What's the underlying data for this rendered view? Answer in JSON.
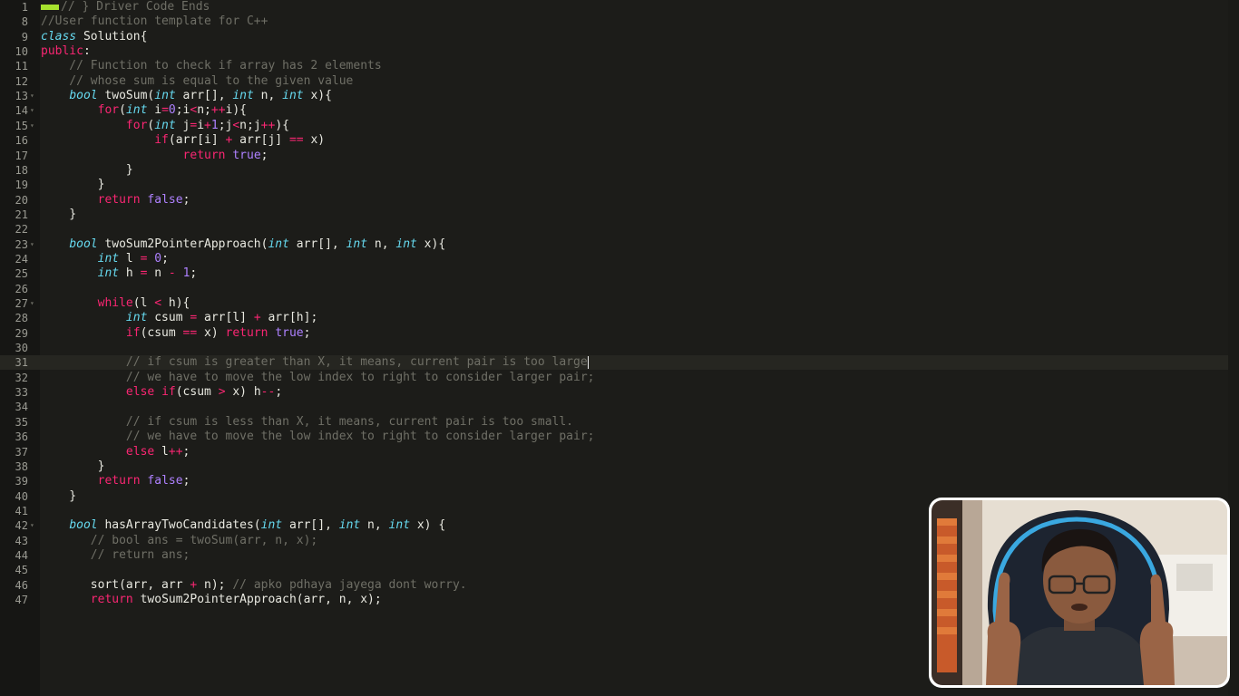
{
  "editor": {
    "lines": [
      {
        "n": "1",
        "fold": "",
        "tokens": [
          {
            "c": "bar",
            "t": ""
          },
          {
            "c": "cm",
            "t": "// } Driver Code Ends"
          }
        ]
      },
      {
        "n": "8",
        "fold": "",
        "tokens": [
          {
            "c": "cm",
            "t": "//User function template for C++"
          }
        ]
      },
      {
        "n": "9",
        "fold": "",
        "tokens": [
          {
            "c": "ty",
            "t": "class"
          },
          {
            "c": "plain",
            "t": " Solution{"
          }
        ]
      },
      {
        "n": "10",
        "fold": "",
        "tokens": [
          {
            "c": "kw",
            "t": "public"
          },
          {
            "c": "plain",
            "t": ":"
          }
        ]
      },
      {
        "n": "11",
        "fold": "",
        "tokens": [
          {
            "c": "cm",
            "t": "    // Function to check if array has 2 elements"
          }
        ]
      },
      {
        "n": "12",
        "fold": "",
        "tokens": [
          {
            "c": "cm",
            "t": "    // whose sum is equal to the given value"
          }
        ]
      },
      {
        "n": "13",
        "fold": "▾",
        "tokens": [
          {
            "c": "plain",
            "t": "    "
          },
          {
            "c": "ty",
            "t": "bool"
          },
          {
            "c": "plain",
            "t": " twoSum("
          },
          {
            "c": "ty",
            "t": "int"
          },
          {
            "c": "plain",
            "t": " arr[], "
          },
          {
            "c": "ty",
            "t": "int"
          },
          {
            "c": "plain",
            "t": " n, "
          },
          {
            "c": "ty",
            "t": "int"
          },
          {
            "c": "plain",
            "t": " x){"
          }
        ]
      },
      {
        "n": "14",
        "fold": "▾",
        "tokens": [
          {
            "c": "plain",
            "t": "        "
          },
          {
            "c": "kw",
            "t": "for"
          },
          {
            "c": "plain",
            "t": "("
          },
          {
            "c": "ty",
            "t": "int"
          },
          {
            "c": "plain",
            "t": " i"
          },
          {
            "c": "kw",
            "t": "="
          },
          {
            "c": "lit",
            "t": "0"
          },
          {
            "c": "plain",
            "t": ";i"
          },
          {
            "c": "kw",
            "t": "<"
          },
          {
            "c": "plain",
            "t": "n;"
          },
          {
            "c": "kw",
            "t": "++"
          },
          {
            "c": "plain",
            "t": "i){"
          }
        ]
      },
      {
        "n": "15",
        "fold": "▾",
        "tokens": [
          {
            "c": "plain",
            "t": "            "
          },
          {
            "c": "kw",
            "t": "for"
          },
          {
            "c": "plain",
            "t": "("
          },
          {
            "c": "ty",
            "t": "int"
          },
          {
            "c": "plain",
            "t": " j"
          },
          {
            "c": "kw",
            "t": "="
          },
          {
            "c": "plain",
            "t": "i"
          },
          {
            "c": "kw",
            "t": "+"
          },
          {
            "c": "lit",
            "t": "1"
          },
          {
            "c": "plain",
            "t": ";j"
          },
          {
            "c": "kw",
            "t": "<"
          },
          {
            "c": "plain",
            "t": "n;j"
          },
          {
            "c": "kw",
            "t": "++"
          },
          {
            "c": "plain",
            "t": "){"
          }
        ]
      },
      {
        "n": "16",
        "fold": "",
        "tokens": [
          {
            "c": "plain",
            "t": "                "
          },
          {
            "c": "kw",
            "t": "if"
          },
          {
            "c": "plain",
            "t": "(arr[i] "
          },
          {
            "c": "kw",
            "t": "+"
          },
          {
            "c": "plain",
            "t": " arr[j] "
          },
          {
            "c": "kw",
            "t": "=="
          },
          {
            "c": "plain",
            "t": " x)"
          }
        ]
      },
      {
        "n": "17",
        "fold": "",
        "tokens": [
          {
            "c": "plain",
            "t": "                    "
          },
          {
            "c": "kw",
            "t": "return"
          },
          {
            "c": "plain",
            "t": " "
          },
          {
            "c": "lit",
            "t": "true"
          },
          {
            "c": "plain",
            "t": ";"
          }
        ]
      },
      {
        "n": "18",
        "fold": "",
        "tokens": [
          {
            "c": "plain",
            "t": "            }"
          }
        ]
      },
      {
        "n": "19",
        "fold": "",
        "tokens": [
          {
            "c": "plain",
            "t": "        }"
          }
        ]
      },
      {
        "n": "20",
        "fold": "",
        "tokens": [
          {
            "c": "plain",
            "t": "        "
          },
          {
            "c": "kw",
            "t": "return"
          },
          {
            "c": "plain",
            "t": " "
          },
          {
            "c": "lit",
            "t": "false"
          },
          {
            "c": "plain",
            "t": ";"
          }
        ]
      },
      {
        "n": "21",
        "fold": "",
        "tokens": [
          {
            "c": "plain",
            "t": "    }"
          }
        ]
      },
      {
        "n": "22",
        "fold": "",
        "tokens": []
      },
      {
        "n": "23",
        "fold": "▾",
        "tokens": [
          {
            "c": "plain",
            "t": "    "
          },
          {
            "c": "ty",
            "t": "bool"
          },
          {
            "c": "plain",
            "t": " twoSum2PointerApproach("
          },
          {
            "c": "ty",
            "t": "int"
          },
          {
            "c": "plain",
            "t": " arr[], "
          },
          {
            "c": "ty",
            "t": "int"
          },
          {
            "c": "plain",
            "t": " n, "
          },
          {
            "c": "ty",
            "t": "int"
          },
          {
            "c": "plain",
            "t": " x){"
          }
        ]
      },
      {
        "n": "24",
        "fold": "",
        "tokens": [
          {
            "c": "plain",
            "t": "        "
          },
          {
            "c": "ty",
            "t": "int"
          },
          {
            "c": "plain",
            "t": " l "
          },
          {
            "c": "kw",
            "t": "="
          },
          {
            "c": "plain",
            "t": " "
          },
          {
            "c": "lit",
            "t": "0"
          },
          {
            "c": "plain",
            "t": ";"
          }
        ]
      },
      {
        "n": "25",
        "fold": "",
        "tokens": [
          {
            "c": "plain",
            "t": "        "
          },
          {
            "c": "ty",
            "t": "int"
          },
          {
            "c": "plain",
            "t": " h "
          },
          {
            "c": "kw",
            "t": "="
          },
          {
            "c": "plain",
            "t": " n "
          },
          {
            "c": "kw",
            "t": "-"
          },
          {
            "c": "plain",
            "t": " "
          },
          {
            "c": "lit",
            "t": "1"
          },
          {
            "c": "plain",
            "t": ";"
          }
        ]
      },
      {
        "n": "26",
        "fold": "",
        "tokens": []
      },
      {
        "n": "27",
        "fold": "▾",
        "tokens": [
          {
            "c": "plain",
            "t": "        "
          },
          {
            "c": "kw",
            "t": "while"
          },
          {
            "c": "plain",
            "t": "(l "
          },
          {
            "c": "kw",
            "t": "<"
          },
          {
            "c": "plain",
            "t": " h){"
          }
        ]
      },
      {
        "n": "28",
        "fold": "",
        "tokens": [
          {
            "c": "plain",
            "t": "            "
          },
          {
            "c": "ty",
            "t": "int"
          },
          {
            "c": "plain",
            "t": " csum "
          },
          {
            "c": "kw",
            "t": "="
          },
          {
            "c": "plain",
            "t": " arr[l] "
          },
          {
            "c": "kw",
            "t": "+"
          },
          {
            "c": "plain",
            "t": " arr[h];"
          }
        ]
      },
      {
        "n": "29",
        "fold": "",
        "tokens": [
          {
            "c": "plain",
            "t": "            "
          },
          {
            "c": "kw",
            "t": "if"
          },
          {
            "c": "plain",
            "t": "(csum "
          },
          {
            "c": "kw",
            "t": "=="
          },
          {
            "c": "plain",
            "t": " x) "
          },
          {
            "c": "kw",
            "t": "return"
          },
          {
            "c": "plain",
            "t": " "
          },
          {
            "c": "lit",
            "t": "true"
          },
          {
            "c": "plain",
            "t": ";"
          }
        ]
      },
      {
        "n": "30",
        "fold": "",
        "tokens": []
      },
      {
        "n": "31",
        "fold": "",
        "active": true,
        "tokens": [
          {
            "c": "cm",
            "t": "            // if csum is greater than X, it means, current pair is too large"
          },
          {
            "c": "caret",
            "t": ""
          }
        ]
      },
      {
        "n": "32",
        "fold": "",
        "tokens": [
          {
            "c": "cm",
            "t": "            // we have to move the low index to right to consider larger pair;"
          }
        ]
      },
      {
        "n": "33",
        "fold": "",
        "tokens": [
          {
            "c": "plain",
            "t": "            "
          },
          {
            "c": "kw",
            "t": "else"
          },
          {
            "c": "plain",
            "t": " "
          },
          {
            "c": "kw",
            "t": "if"
          },
          {
            "c": "plain",
            "t": "(csum "
          },
          {
            "c": "kw",
            "t": ">"
          },
          {
            "c": "plain",
            "t": " x) h"
          },
          {
            "c": "kw",
            "t": "--"
          },
          {
            "c": "plain",
            "t": ";"
          }
        ]
      },
      {
        "n": "34",
        "fold": "",
        "tokens": []
      },
      {
        "n": "35",
        "fold": "",
        "tokens": [
          {
            "c": "cm",
            "t": "            // if csum is less than X, it means, current pair is too small."
          }
        ]
      },
      {
        "n": "36",
        "fold": "",
        "tokens": [
          {
            "c": "cm",
            "t": "            // we have to move the low index to right to consider larger pair;"
          }
        ]
      },
      {
        "n": "37",
        "fold": "",
        "tokens": [
          {
            "c": "plain",
            "t": "            "
          },
          {
            "c": "kw",
            "t": "else"
          },
          {
            "c": "plain",
            "t": " l"
          },
          {
            "c": "kw",
            "t": "++"
          },
          {
            "c": "plain",
            "t": ";"
          }
        ]
      },
      {
        "n": "38",
        "fold": "",
        "tokens": [
          {
            "c": "plain",
            "t": "        }"
          }
        ]
      },
      {
        "n": "39",
        "fold": "",
        "tokens": [
          {
            "c": "plain",
            "t": "        "
          },
          {
            "c": "kw",
            "t": "return"
          },
          {
            "c": "plain",
            "t": " "
          },
          {
            "c": "lit",
            "t": "false"
          },
          {
            "c": "plain",
            "t": ";"
          }
        ]
      },
      {
        "n": "40",
        "fold": "",
        "tokens": [
          {
            "c": "plain",
            "t": "    }"
          }
        ]
      },
      {
        "n": "41",
        "fold": "",
        "tokens": []
      },
      {
        "n": "42",
        "fold": "▾",
        "tokens": [
          {
            "c": "plain",
            "t": "    "
          },
          {
            "c": "ty",
            "t": "bool"
          },
          {
            "c": "plain",
            "t": " hasArrayTwoCandidates("
          },
          {
            "c": "ty",
            "t": "int"
          },
          {
            "c": "plain",
            "t": " arr[], "
          },
          {
            "c": "ty",
            "t": "int"
          },
          {
            "c": "plain",
            "t": " n, "
          },
          {
            "c": "ty",
            "t": "int"
          },
          {
            "c": "plain",
            "t": " x) {"
          }
        ]
      },
      {
        "n": "43",
        "fold": "",
        "tokens": [
          {
            "c": "cm",
            "t": "       // bool ans = twoSum(arr, n, x);"
          }
        ]
      },
      {
        "n": "44",
        "fold": "",
        "tokens": [
          {
            "c": "cm",
            "t": "       // return ans;"
          }
        ]
      },
      {
        "n": "45",
        "fold": "",
        "tokens": []
      },
      {
        "n": "46",
        "fold": "",
        "tokens": [
          {
            "c": "plain",
            "t": "       sort(arr, arr "
          },
          {
            "c": "kw",
            "t": "+"
          },
          {
            "c": "plain",
            "t": " n); "
          },
          {
            "c": "cm",
            "t": "// apko pdhaya jayega dont worry."
          }
        ]
      },
      {
        "n": "47",
        "fold": "",
        "tokens": [
          {
            "c": "plain",
            "t": "       "
          },
          {
            "c": "kw",
            "t": "return"
          },
          {
            "c": "plain",
            "t": " twoSum2PointerApproach(arr, n, x);"
          }
        ]
      }
    ]
  },
  "colors": {
    "background": "#1c1c19",
    "keyword": "#f92672",
    "type": "#66d9ef",
    "literal": "#ae81ff",
    "comment": "#6f6f66"
  },
  "webcam": {
    "description_icon": "presenter-webcam"
  }
}
